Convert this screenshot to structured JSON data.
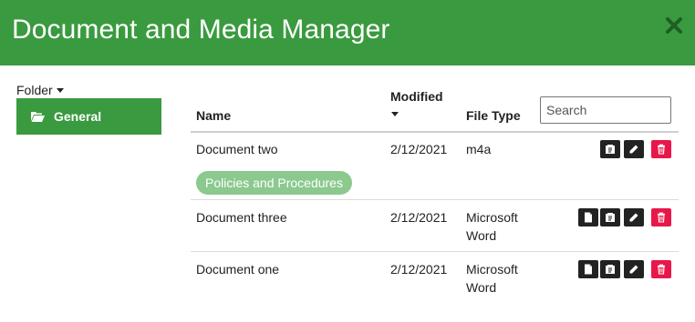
{
  "header": {
    "title": "Document and Media Manager",
    "close_icon": "close-icon"
  },
  "sidebar": {
    "folder_label": "Folder",
    "folders": [
      {
        "label": "General",
        "icon": "folder-open-icon",
        "active": true
      }
    ]
  },
  "table": {
    "columns": {
      "name": "Name",
      "modified": "Modified",
      "file_type": "File Type"
    },
    "search_placeholder": "Search",
    "rows": [
      {
        "name": "Document two",
        "modified": "2/12/2021",
        "file_type": "m4a"
      },
      {
        "name": "Document three",
        "modified": "2/12/2021",
        "file_type": "Microsoft Word"
      },
      {
        "name": "Document one",
        "modified": "2/12/2021",
        "file_type": "Microsoft Word"
      }
    ],
    "group_label": "Policies and Procedures"
  },
  "colors": {
    "brand_green": "#3a9a3f",
    "pill_green": "#8bc98e",
    "delete_red": "#e8174a",
    "action_dark": "#222222"
  }
}
